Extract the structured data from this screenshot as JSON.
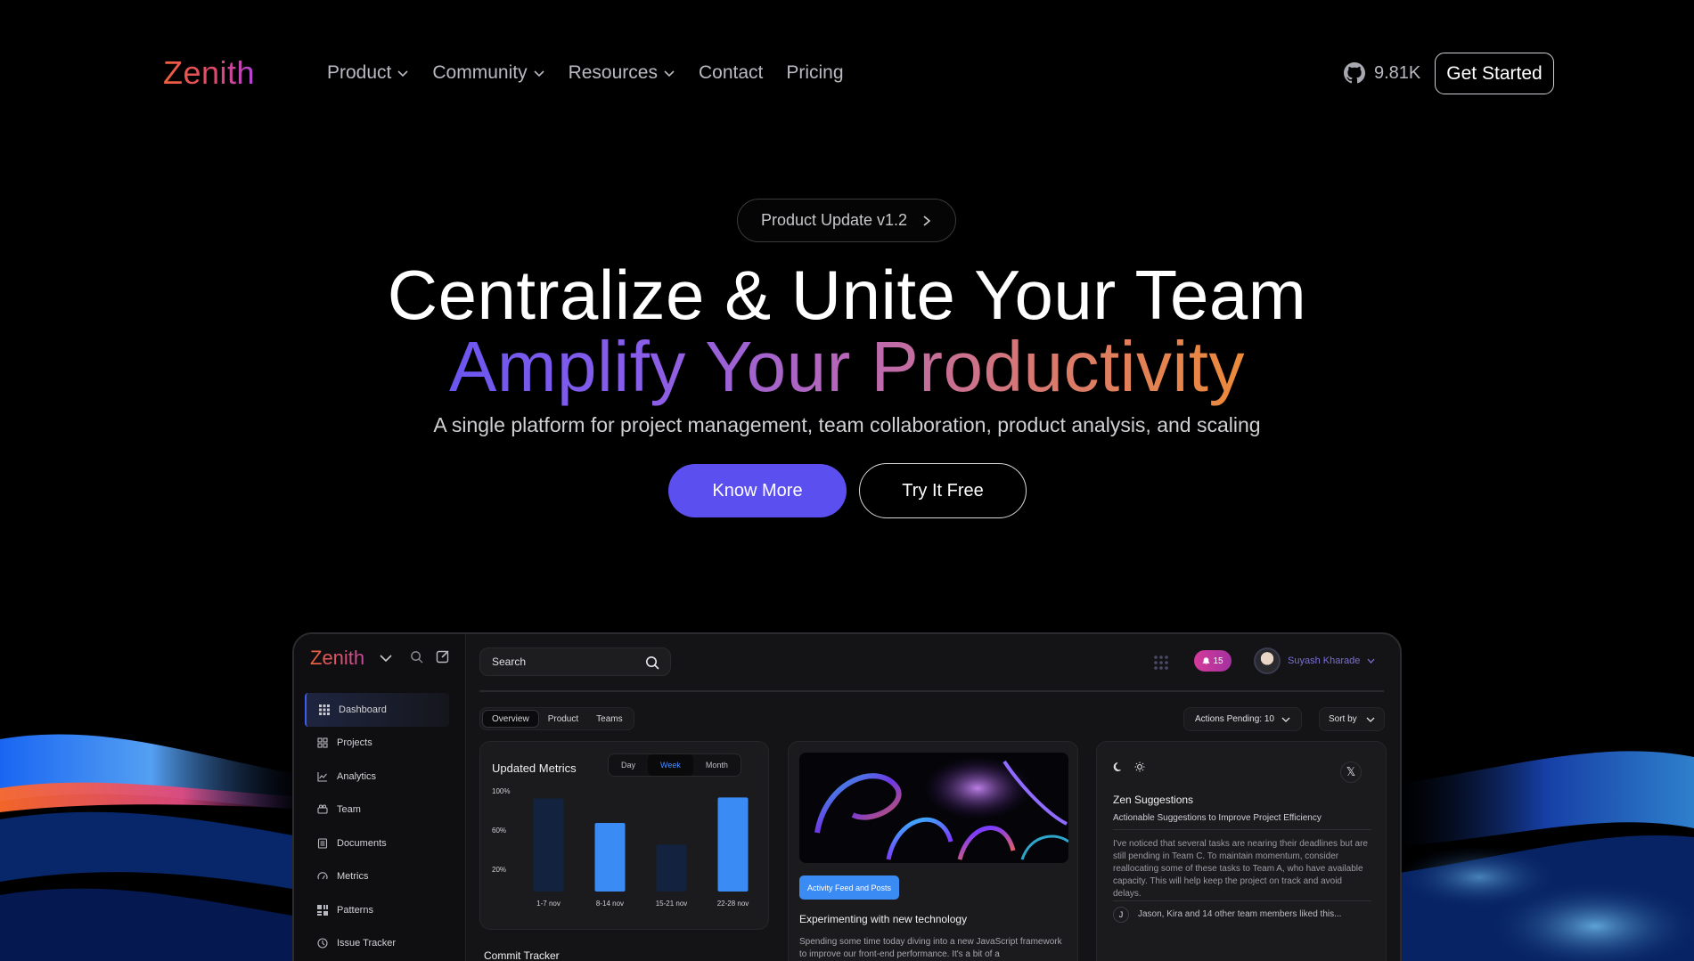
{
  "nav": {
    "logo": "Zenith",
    "links": [
      {
        "label": "Product",
        "dropdown": true
      },
      {
        "label": "Community",
        "dropdown": true
      },
      {
        "label": "Resources",
        "dropdown": true
      },
      {
        "label": "Contact",
        "dropdown": false
      },
      {
        "label": "Pricing",
        "dropdown": false
      }
    ],
    "github_stars": "9.81K",
    "cta": "Get Started"
  },
  "hero": {
    "pill": "Product Update v1.2",
    "headline_1": "Centralize & Unite Your Team",
    "headline_2": "Amplify Your Productivity",
    "subtitle": "A single platform for project management, team collaboration, product analysis, and scaling",
    "primary_button": "Know More",
    "secondary_button": "Try It Free"
  },
  "dashboard": {
    "logo": "Zenith",
    "sidebar": [
      {
        "label": "Dashboard",
        "icon": "grid-icon",
        "active": true
      },
      {
        "label": "Projects",
        "icon": "projects-icon",
        "active": false
      },
      {
        "label": "Analytics",
        "icon": "analytics-icon",
        "active": false
      },
      {
        "label": "Team",
        "icon": "team-icon",
        "active": false
      },
      {
        "label": "Documents",
        "icon": "documents-icon",
        "active": false
      },
      {
        "label": "Metrics",
        "icon": "metrics-icon",
        "active": false
      },
      {
        "label": "Patterns",
        "icon": "patterns-icon",
        "active": false
      },
      {
        "label": "Issue Tracker",
        "icon": "issue-tracker-icon",
        "active": false
      }
    ],
    "search_placeholder": "Search",
    "notifications": "15",
    "user_name": "Suyash Kharade",
    "tabs": [
      "Overview",
      "Product",
      "Teams"
    ],
    "active_tab": "Overview",
    "actions_pending": "Actions Pending: 10",
    "sort_by": "Sort by",
    "metrics_card": {
      "title": "Updated Metrics",
      "ranges": [
        "Day",
        "Week",
        "Month"
      ],
      "active_range": "Week"
    },
    "activity_card": {
      "tag": "Activity Feed and Posts",
      "title": "Experimenting with new technology",
      "body": "Spending some time today diving into a new JavaScript framework to improve our front-end performance. It's a bit of a"
    },
    "suggestions_card": {
      "title": "Zen Suggestions",
      "subtitle": "Actionable Suggestions to Improve Project Efficiency",
      "body": "I've noticed that several tasks are nearing their deadlines but are still pending in Team C. To maintain momentum, consider reallocating some of these tasks to Team A, who have available capacity. This will help keep the project on track and avoid delays.",
      "footer_initial": "J",
      "footer": "Jason, Kira and 14 other team members liked this..."
    },
    "commit_tracker": "Commit Tracker"
  },
  "colors": {
    "accent": "#5b4ff0",
    "bar_highlight": "#3b8bf5",
    "bar_dim": "#13233f",
    "notification": "#d43a9a"
  },
  "chart_data": {
    "type": "bar",
    "title": "Updated Metrics",
    "categories": [
      "1-7 nov",
      "8-14 nov",
      "15-21 nov",
      "22-28 nov"
    ],
    "values": [
      95,
      70,
      48,
      96
    ],
    "highlighted": [
      false,
      true,
      false,
      true
    ],
    "ytick_labels": [
      "100%",
      "60%",
      "20%"
    ],
    "yticks": [
      100,
      60,
      20
    ],
    "ylim": [
      0,
      100
    ]
  }
}
